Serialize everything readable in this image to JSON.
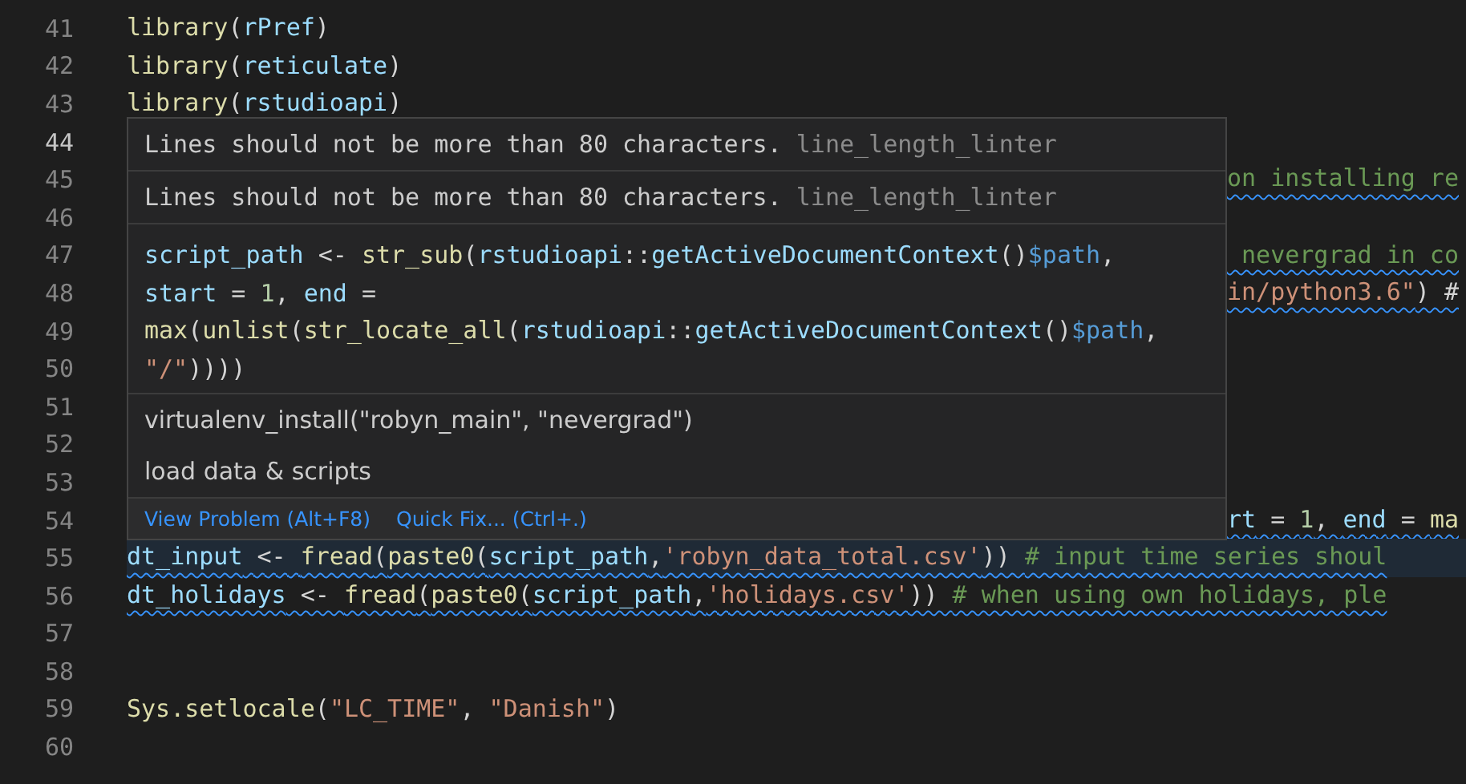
{
  "editor": {
    "lines": [
      {
        "number": "41",
        "active": false,
        "tokens": [
          {
            "t": "library",
            "kind": "fn"
          },
          {
            "t": "(",
            "kind": "p"
          },
          {
            "t": "rPref",
            "kind": "var"
          },
          {
            "t": ")",
            "kind": "p"
          }
        ]
      },
      {
        "number": "42",
        "active": false,
        "tokens": [
          {
            "t": "library",
            "kind": "fn"
          },
          {
            "t": "(",
            "kind": "p"
          },
          {
            "t": "reticulate",
            "kind": "var"
          },
          {
            "t": ")",
            "kind": "p"
          }
        ]
      },
      {
        "number": "43",
        "active": false,
        "tokens": [
          {
            "t": "library",
            "kind": "fn"
          },
          {
            "t": "(",
            "kind": "p"
          },
          {
            "t": "rstudioapi",
            "kind": "var"
          },
          {
            "t": ")",
            "kind": "p"
          }
        ]
      },
      {
        "number": "44",
        "active": true
      },
      {
        "number": "45",
        "active": false,
        "covered": true,
        "squiggle": true,
        "tokens": [
          {
            "t": "on installing re",
            "kind": "cm"
          }
        ]
      },
      {
        "number": "46",
        "active": false
      },
      {
        "number": "47",
        "active": false,
        "covered": true,
        "squiggle": true,
        "tokens": [
          {
            "t": " nevergrad in co",
            "kind": "cm"
          }
        ]
      },
      {
        "number": "48",
        "active": false,
        "covered": true,
        "squiggle": true,
        "tokens": [
          {
            "t": "in/python3.6\"",
            "kind": "str"
          },
          {
            "t": ") #",
            "kind": "p"
          }
        ]
      },
      {
        "number": "49",
        "active": false
      },
      {
        "number": "50",
        "active": false
      },
      {
        "number": "51",
        "active": false
      },
      {
        "number": "52",
        "active": false
      },
      {
        "number": "53",
        "active": false
      },
      {
        "number": "54",
        "active": false,
        "covered": true,
        "squiggle": true,
        "tokens": [
          {
            "t": "rt",
            "kind": "var"
          },
          {
            "t": " = ",
            "kind": "p"
          },
          {
            "t": "1",
            "kind": "num"
          },
          {
            "t": ", ",
            "kind": "p"
          },
          {
            "t": "end",
            "kind": "var"
          },
          {
            "t": " = ",
            "kind": "p"
          },
          {
            "t": "ma",
            "kind": "fn"
          }
        ]
      },
      {
        "number": "55",
        "active": false,
        "highlighted": true,
        "squiggle": true,
        "tokens": [
          {
            "t": "dt_input",
            "kind": "var"
          },
          {
            "t": " <- ",
            "kind": "p"
          },
          {
            "t": "fread",
            "kind": "fn"
          },
          {
            "t": "(",
            "kind": "p"
          },
          {
            "t": "paste0",
            "kind": "fn"
          },
          {
            "t": "(",
            "kind": "p"
          },
          {
            "t": "script_path",
            "kind": "var"
          },
          {
            "t": ",",
            "kind": "p"
          },
          {
            "t": "'robyn_data_total.csv'",
            "kind": "str"
          },
          {
            "t": ")) ",
            "kind": "p"
          },
          {
            "t": "# input time series shoul",
            "kind": "cm"
          }
        ]
      },
      {
        "number": "56",
        "active": false,
        "squiggle": true,
        "tokens": [
          {
            "t": "dt_holidays",
            "kind": "var"
          },
          {
            "t": " <- ",
            "kind": "p"
          },
          {
            "t": "fread",
            "kind": "fn"
          },
          {
            "t": "(",
            "kind": "p"
          },
          {
            "t": "paste0",
            "kind": "fn"
          },
          {
            "t": "(",
            "kind": "p"
          },
          {
            "t": "script_path",
            "kind": "var"
          },
          {
            "t": ",",
            "kind": "p"
          },
          {
            "t": "'holidays.csv'",
            "kind": "str"
          },
          {
            "t": ")) ",
            "kind": "p"
          },
          {
            "t": "# when using own holidays, ple",
            "kind": "cm"
          }
        ]
      },
      {
        "number": "57",
        "active": false
      },
      {
        "number": "58",
        "active": false
      },
      {
        "number": "59",
        "active": false,
        "tokens": [
          {
            "t": "Sys.setlocale",
            "kind": "fn"
          },
          {
            "t": "(",
            "kind": "p"
          },
          {
            "t": "\"LC_TIME\"",
            "kind": "str"
          },
          {
            "t": ", ",
            "kind": "p"
          },
          {
            "t": "\"Danish\"",
            "kind": "str"
          },
          {
            "t": ")",
            "kind": "p"
          }
        ]
      },
      {
        "number": "60",
        "active": false
      }
    ]
  },
  "hover": {
    "diagnostics": [
      {
        "message": "Lines should not be more than 80 characters.",
        "source": "line_length_linter"
      },
      {
        "message": "Lines should not be more than 80 characters.",
        "source": "line_length_linter"
      }
    ],
    "code": [
      [
        {
          "t": "script_path",
          "kind": "var"
        },
        {
          "t": " <- ",
          "kind": "p"
        },
        {
          "t": "str_sub",
          "kind": "fn"
        },
        {
          "t": "(",
          "kind": "p"
        },
        {
          "t": "rstudioapi",
          "kind": "var"
        },
        {
          "t": "::",
          "kind": "p"
        },
        {
          "t": "getActiveDocumentContext",
          "kind": "var"
        },
        {
          "t": "()",
          "kind": "p"
        },
        {
          "t": "$path",
          "kind": "kw"
        },
        {
          "t": ",",
          "kind": "p"
        }
      ],
      [
        {
          "t": "start",
          "kind": "var"
        },
        {
          "t": " = ",
          "kind": "p"
        },
        {
          "t": "1",
          "kind": "num"
        },
        {
          "t": ", ",
          "kind": "p"
        },
        {
          "t": "end",
          "kind": "var"
        },
        {
          "t": " =",
          "kind": "p"
        }
      ],
      [
        {
          "t": "max",
          "kind": "fn"
        },
        {
          "t": "(",
          "kind": "p"
        },
        {
          "t": "unlist",
          "kind": "fn"
        },
        {
          "t": "(",
          "kind": "p"
        },
        {
          "t": "str_locate_all",
          "kind": "fn"
        },
        {
          "t": "(",
          "kind": "p"
        },
        {
          "t": "rstudioapi",
          "kind": "var"
        },
        {
          "t": "::",
          "kind": "p"
        },
        {
          "t": "getActiveDocumentContext",
          "kind": "var"
        },
        {
          "t": "()",
          "kind": "p"
        },
        {
          "t": "$path",
          "kind": "kw"
        },
        {
          "t": ",",
          "kind": "p"
        }
      ],
      [
        {
          "t": "\"/\"",
          "kind": "str"
        },
        {
          "t": "))))",
          "kind": "p"
        }
      ]
    ],
    "text": [
      "virtualenv_install(\"robyn_main\", \"nevergrad\")",
      "load data & scripts"
    ],
    "actions": [
      "View Problem (Alt+F8)",
      "Quick Fix... (Ctrl+.)"
    ]
  }
}
